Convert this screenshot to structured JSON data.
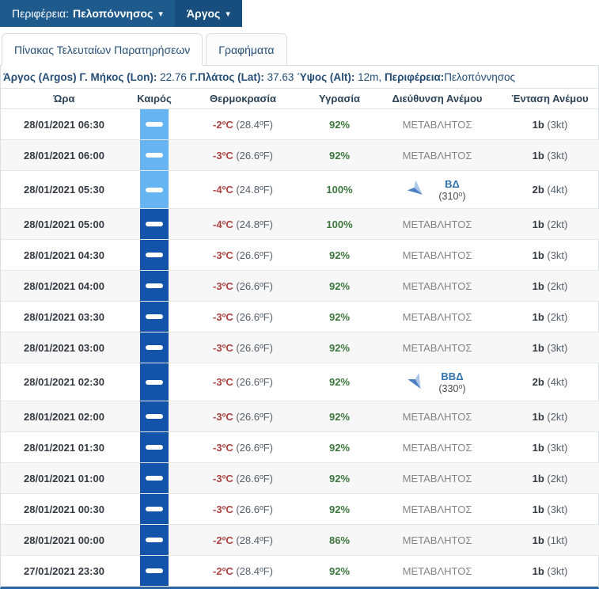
{
  "colors": {
    "navbar": "#1e5a8c",
    "navbar_active": "#174e7d",
    "icon_light": "#66b5f2",
    "icon_dark": "#1353a9",
    "temp_red": "#a94442",
    "humidity_green": "#3c763d",
    "wind_blue": "#3173ad"
  },
  "navbar": {
    "region_label": "Περιφέρεια:",
    "region_value": "Πελοπόννησος",
    "station": "Άργος",
    "caret": "▾"
  },
  "tabs": {
    "observations": "Πίνακας Τελευταίων Παρατηρήσεων",
    "charts": "Γραφήματα"
  },
  "station_info": {
    "name": "Άργος (Argos)",
    "lon_label": "Γ. Μήκος (Lon):",
    "lon": "22.76",
    "lat_label": "Γ.Πλάτος (Lat):",
    "lat": "37.63",
    "alt_label": "Ύψος (Alt):",
    "alt": "12m,",
    "region_label": "Περιφέρεια:",
    "region": "Πελοπόννησος"
  },
  "table": {
    "headers": [
      "Ώρα",
      "Καιρός",
      "Θερμοκρασία",
      "Υγρασία",
      "Διεύθυνση Ανέμου",
      "Ένταση Ανέμου"
    ],
    "rows": [
      {
        "time": "28/01/2021 06:30",
        "icon": "light",
        "temp_c": "-2ºC",
        "temp_f": "(28.4ºF)",
        "humidity": "92%",
        "wind": {
          "type": "variable",
          "label": "ΜΕΤΑΒΛΗΤΟΣ"
        },
        "beaufort": "1b",
        "knots": "(3kt)"
      },
      {
        "time": "28/01/2021 06:00",
        "icon": "light",
        "temp_c": "-3ºC",
        "temp_f": "(26.6ºF)",
        "humidity": "92%",
        "wind": {
          "type": "variable",
          "label": "ΜΕΤΑΒΛΗΤΟΣ"
        },
        "beaufort": "1b",
        "knots": "(3kt)"
      },
      {
        "time": "28/01/2021 05:30",
        "icon": "light",
        "temp_c": "-4ºC",
        "temp_f": "(24.8ºF)",
        "humidity": "100%",
        "wind": {
          "type": "direction",
          "label": "ΒΔ",
          "deg": "(310⁰)",
          "rotation": 130
        },
        "beaufort": "2b",
        "knots": "(4kt)"
      },
      {
        "time": "28/01/2021 05:00",
        "icon": "dark",
        "temp_c": "-4ºC",
        "temp_f": "(24.8ºF)",
        "humidity": "100%",
        "wind": {
          "type": "variable",
          "label": "ΜΕΤΑΒΛΗΤΟΣ"
        },
        "beaufort": "1b",
        "knots": "(2kt)"
      },
      {
        "time": "28/01/2021 04:30",
        "icon": "dark",
        "temp_c": "-3ºC",
        "temp_f": "(26.6ºF)",
        "humidity": "92%",
        "wind": {
          "type": "variable",
          "label": "ΜΕΤΑΒΛΗΤΟΣ"
        },
        "beaufort": "1b",
        "knots": "(3kt)"
      },
      {
        "time": "28/01/2021 04:00",
        "icon": "dark",
        "temp_c": "-3ºC",
        "temp_f": "(26.6ºF)",
        "humidity": "92%",
        "wind": {
          "type": "variable",
          "label": "ΜΕΤΑΒΛΗΤΟΣ"
        },
        "beaufort": "1b",
        "knots": "(2kt)"
      },
      {
        "time": "28/01/2021 03:30",
        "icon": "dark",
        "temp_c": "-3ºC",
        "temp_f": "(26.6ºF)",
        "humidity": "92%",
        "wind": {
          "type": "variable",
          "label": "ΜΕΤΑΒΛΗΤΟΣ"
        },
        "beaufort": "1b",
        "knots": "(2kt)"
      },
      {
        "time": "28/01/2021 03:00",
        "icon": "dark",
        "temp_c": "-3ºC",
        "temp_f": "(26.6ºF)",
        "humidity": "92%",
        "wind": {
          "type": "variable",
          "label": "ΜΕΤΑΒΛΗΤΟΣ"
        },
        "beaufort": "1b",
        "knots": "(3kt)"
      },
      {
        "time": "28/01/2021 02:30",
        "icon": "dark",
        "temp_c": "-3ºC",
        "temp_f": "(26.6ºF)",
        "humidity": "92%",
        "wind": {
          "type": "direction",
          "label": "ΒΒΔ",
          "deg": "(330⁰)",
          "rotation": 150
        },
        "beaufort": "2b",
        "knots": "(4kt)"
      },
      {
        "time": "28/01/2021 02:00",
        "icon": "dark",
        "temp_c": "-3ºC",
        "temp_f": "(26.6ºF)",
        "humidity": "92%",
        "wind": {
          "type": "variable",
          "label": "ΜΕΤΑΒΛΗΤΟΣ"
        },
        "beaufort": "1b",
        "knots": "(2kt)"
      },
      {
        "time": "28/01/2021 01:30",
        "icon": "dark",
        "temp_c": "-3ºC",
        "temp_f": "(26.6ºF)",
        "humidity": "92%",
        "wind": {
          "type": "variable",
          "label": "ΜΕΤΑΒΛΗΤΟΣ"
        },
        "beaufort": "1b",
        "knots": "(3kt)"
      },
      {
        "time": "28/01/2021 01:00",
        "icon": "dark",
        "temp_c": "-3ºC",
        "temp_f": "(26.6ºF)",
        "humidity": "92%",
        "wind": {
          "type": "variable",
          "label": "ΜΕΤΑΒΛΗΤΟΣ"
        },
        "beaufort": "1b",
        "knots": "(2kt)"
      },
      {
        "time": "28/01/2021 00:30",
        "icon": "dark",
        "temp_c": "-3ºC",
        "temp_f": "(26.6ºF)",
        "humidity": "92%",
        "wind": {
          "type": "variable",
          "label": "ΜΕΤΑΒΛΗΤΟΣ"
        },
        "beaufort": "1b",
        "knots": "(3kt)"
      },
      {
        "time": "28/01/2021 00:00",
        "icon": "dark",
        "temp_c": "-2ºC",
        "temp_f": "(28.4ºF)",
        "humidity": "86%",
        "wind": {
          "type": "variable",
          "label": "ΜΕΤΑΒΛΗΤΟΣ"
        },
        "beaufort": "1b",
        "knots": "(1kt)"
      },
      {
        "time": "27/01/2021 23:30",
        "icon": "dark",
        "temp_c": "-2ºC",
        "temp_f": "(28.4ºF)",
        "humidity": "92%",
        "wind": {
          "type": "variable",
          "label": "ΜΕΤΑΒΛΗΤΟΣ"
        },
        "beaufort": "1b",
        "knots": "(3kt)"
      }
    ]
  }
}
